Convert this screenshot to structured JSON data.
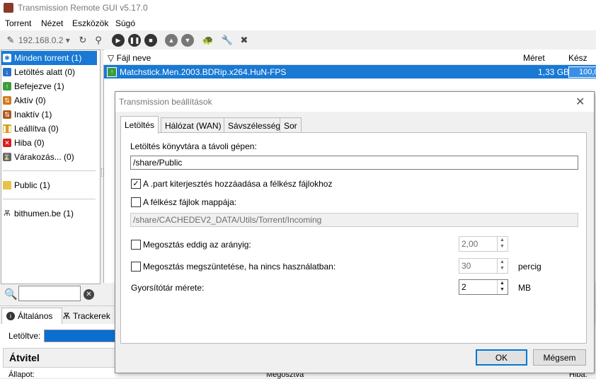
{
  "window": {
    "title": "Transmission Remote GUI v5.17.0"
  },
  "menu": [
    "Torrent",
    "Nézet",
    "Eszközök",
    "Súgó"
  ],
  "toolbar": {
    "host": "192.168.0.2"
  },
  "filters": [
    {
      "label": "Minden torrent (1)",
      "icon": "all-torrents-icon",
      "color": "#1979d3"
    },
    {
      "label": "Letöltés alatt (0)",
      "icon": "download-icon",
      "color": "#2a6fc9"
    },
    {
      "label": "Befejezve (1)",
      "icon": "completed-icon",
      "color": "#3a9d3a"
    },
    {
      "label": "Aktív (0)",
      "icon": "active-icon",
      "color": "#d07a1a"
    },
    {
      "label": "Inaktív (1)",
      "icon": "inactive-icon",
      "color": "#b05a20"
    },
    {
      "label": "Leállítva (0)",
      "icon": "stopped-icon",
      "color": "#d4a017"
    },
    {
      "label": "Hiba (0)",
      "icon": "error-icon",
      "color": "#d32020"
    },
    {
      "label": "Várakozás... (0)",
      "icon": "waiting-icon",
      "color": "#666666"
    }
  ],
  "folders": [
    {
      "label": "Public (1)",
      "icon": "folder-icon"
    }
  ],
  "trackers": [
    {
      "label": "bithumen.be (1)",
      "icon": "tracker-icon"
    }
  ],
  "list": {
    "columns": {
      "name": "Fájl neve",
      "size": "Méret",
      "done": "Kész"
    },
    "rows": [
      {
        "name": "Matchstick.Men.2003.BDRip.x264.HuN-FPS",
        "size": "1,33 GB",
        "done": "100,0",
        "progress": 1.0
      }
    ]
  },
  "bottom": {
    "tabs": [
      "Általános",
      "Trackerek"
    ],
    "downloaded_label": "Letöltve:",
    "section_title": "Átvitel",
    "status_label": "Állapot:",
    "shared_label": "Megosztva",
    "error_label": "Hiba:"
  },
  "dialog": {
    "title": "Transmission beállítások",
    "tabs": [
      "Letöltés",
      "Hálózat (WAN)",
      "Sávszélesség",
      "Sor"
    ],
    "download_dir_label": "Letöltés könyvtára a távoli gépen:",
    "download_dir_value": "/share/Public",
    "part_ext_label": "A .part kiterjesztés hozzáadása a félkész fájlokhoz",
    "part_ext_checked": true,
    "incomplete_dir_label": "A félkész fájlok mappája:",
    "incomplete_dir_checked": false,
    "incomplete_dir_value": "/share/CACHEDEV2_DATA/Utils/Torrent/Incoming",
    "ratio_label": "Megosztás eddig az arányig:",
    "ratio_checked": false,
    "ratio_value": "2,00",
    "idle_label": "Megosztás megszüntetése, ha nincs használatban:",
    "idle_checked": false,
    "idle_value": "30",
    "idle_unit": "percig",
    "cache_label": "Gyorsítótár mérete:",
    "cache_value": "2",
    "cache_unit": "MB",
    "ok_label": "OK",
    "cancel_label": "Mégsem"
  }
}
